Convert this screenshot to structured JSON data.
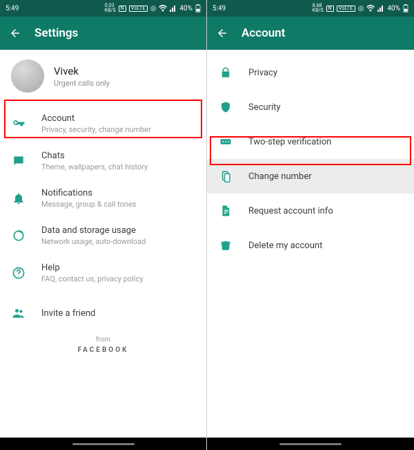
{
  "status": {
    "time": "5:49",
    "kbps_left": "0.03",
    "kbps_right": "8.68",
    "kbps_unit": "KB/S",
    "nfc_label": "N",
    "volte_label": "VoLTE",
    "battery": "40%"
  },
  "left": {
    "title": "Settings",
    "profile": {
      "name": "Vivek",
      "subtitle": "Urgent calls only"
    },
    "items": [
      {
        "title": "Account",
        "subtitle": "Privacy, security, change number"
      },
      {
        "title": "Chats",
        "subtitle": "Theme, wallpapers, chat history"
      },
      {
        "title": "Notifications",
        "subtitle": "Message, group & call tones"
      },
      {
        "title": "Data and storage usage",
        "subtitle": "Network usage, auto-download"
      },
      {
        "title": "Help",
        "subtitle": "FAQ, contact us, privacy policy"
      },
      {
        "title": "Invite a friend",
        "subtitle": ""
      }
    ],
    "footer_from": "from",
    "footer_brand": "FACEBOOK"
  },
  "right": {
    "title": "Account",
    "items": [
      {
        "title": "Privacy"
      },
      {
        "title": "Security"
      },
      {
        "title": "Two-step verification"
      },
      {
        "title": "Change number"
      },
      {
        "title": "Request account info"
      },
      {
        "title": "Delete my account"
      }
    ]
  }
}
